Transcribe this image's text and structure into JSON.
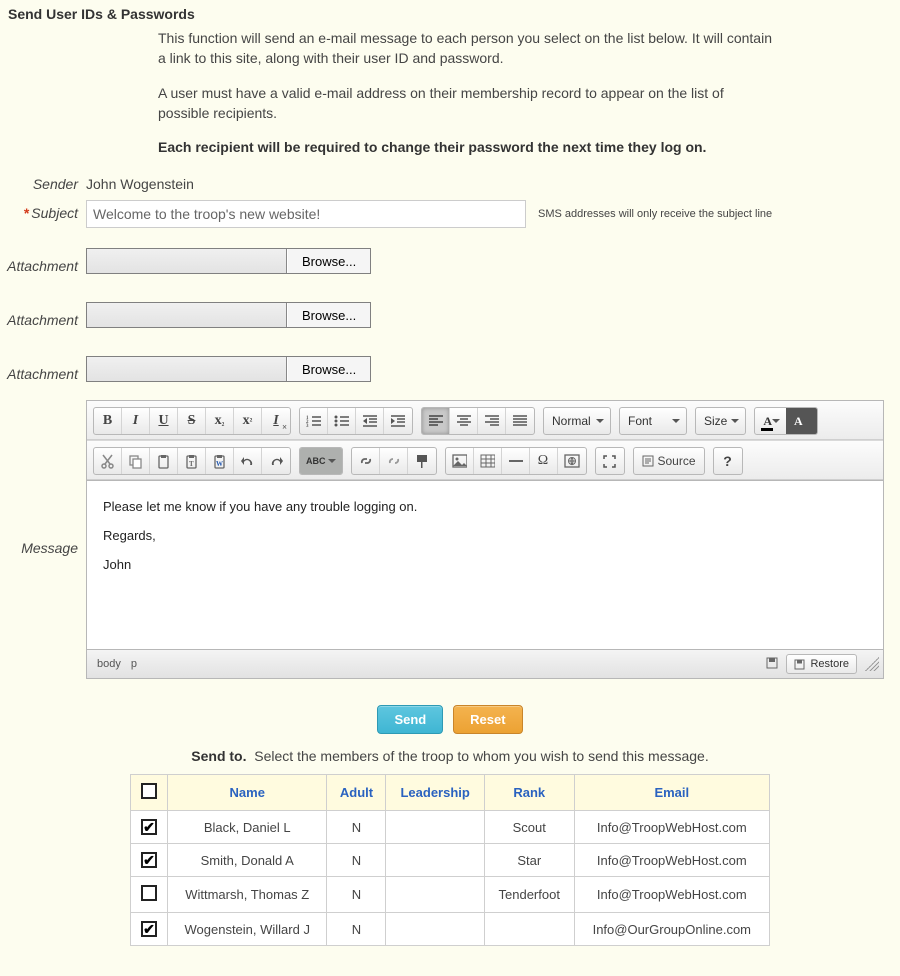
{
  "title": "Send User IDs & Passwords",
  "intro": {
    "p1": "This function will send an e-mail message to each person you select on the list below. It will contain a link to this site, along with their user ID and password.",
    "p2": "A user must have a valid e-mail address on their membership record to appear on the list of possible recipients.",
    "p3": "Each recipient will be required to change their password the next time they log on."
  },
  "labels": {
    "sender": "Sender",
    "subject": "Subject",
    "attachment": "Attachment",
    "message": "Message"
  },
  "sender_value": "John Wogenstein",
  "subject_value": "Welcome to the troop's new website!",
  "sms_note": "SMS addresses will only receive the subject line",
  "browse_label": "Browse...",
  "editor": {
    "format_label": "Normal",
    "font_label": "Font",
    "size_label": "Size",
    "source_label": "Source",
    "body_lines": {
      "l1": "Please let me know if you have any trouble logging on.",
      "l2": "Regards,",
      "l3": "John"
    },
    "path1": "body",
    "path2": "p",
    "restore_label": "Restore"
  },
  "buttons": {
    "send": "Send",
    "reset": "Reset"
  },
  "sendto": {
    "heading": "Send to.",
    "text": "Select the members of the troop to whom you wish to send this message."
  },
  "table": {
    "headers": {
      "name": "Name",
      "adult": "Adult",
      "leadership": "Leadership",
      "rank": "Rank",
      "email": "Email"
    },
    "rows": [
      {
        "checked": true,
        "name": "Black, Daniel L",
        "adult": "N",
        "leadership": "",
        "rank": "Scout",
        "email": "Info@TroopWebHost.com"
      },
      {
        "checked": true,
        "name": "Smith, Donald A",
        "adult": "N",
        "leadership": "",
        "rank": "Star",
        "email": "Info@TroopWebHost.com"
      },
      {
        "checked": false,
        "name": "Wittmarsh, Thomas Z",
        "adult": "N",
        "leadership": "",
        "rank": "Tenderfoot",
        "email": "Info@TroopWebHost.com"
      },
      {
        "checked": true,
        "name": "Wogenstein, Willard J",
        "adult": "N",
        "leadership": "",
        "rank": "",
        "email": "Info@OurGroupOnline.com"
      }
    ]
  }
}
